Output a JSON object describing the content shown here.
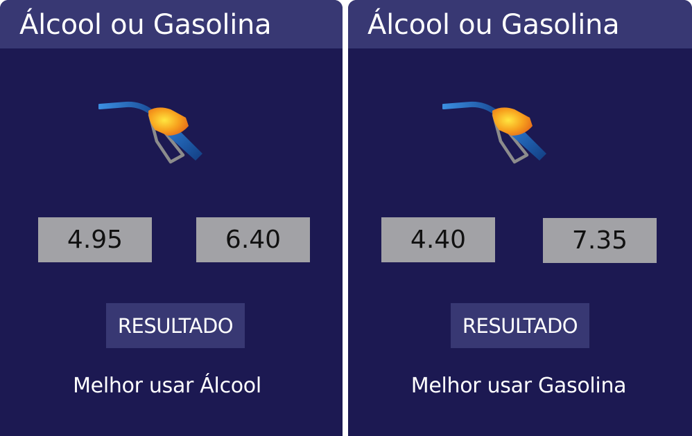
{
  "colors": {
    "background": "#1c1952",
    "app_bar": "#383873",
    "field": "#a2a2a6",
    "button": "#383873",
    "text": "#ffffff",
    "pump_orange": "#f5a623",
    "pump_blue": "#1f5fb0"
  },
  "screens": [
    {
      "title": "Álcool ou Gasolina",
      "icon": "fuel-pump-icon",
      "alcool_price": "4.95",
      "gasolina_price": "6.40",
      "button_label": "RESULTADO",
      "result": "Melhor usar Álcool"
    },
    {
      "title": "Álcool ou Gasolina",
      "icon": "fuel-pump-icon",
      "alcool_price": "4.40",
      "gasolina_price": "7.35",
      "button_label": "RESULTADO",
      "result": "Melhor usar Gasolina"
    }
  ]
}
